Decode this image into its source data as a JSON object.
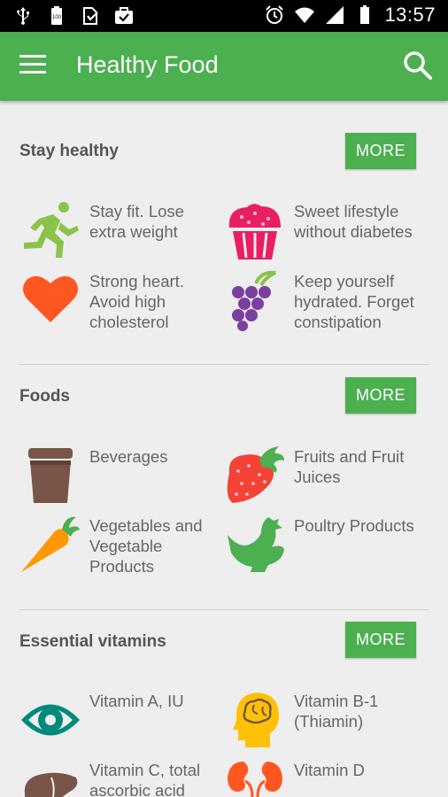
{
  "status": {
    "time": "13:57",
    "battery_level": "100"
  },
  "appbar": {
    "title": "Healthy Food"
  },
  "sections": [
    {
      "title": "Stay healthy",
      "more_label": "MORE",
      "items": [
        {
          "label": "Stay fit. Lose extra weight",
          "icon": "running-person-icon"
        },
        {
          "label": "Sweet lifestyle without diabetes",
          "icon": "cupcake-icon"
        },
        {
          "label": "Strong heart. Avoid high cholesterol",
          "icon": "heart-icon"
        },
        {
          "label": "Keep yourself hydrated. Forget constipation",
          "icon": "grapes-icon"
        }
      ]
    },
    {
      "title": "Foods",
      "more_label": "MORE",
      "items": [
        {
          "label": "Beverages",
          "icon": "coffee-cup-icon"
        },
        {
          "label": "Fruits and Fruit Juices",
          "icon": "strawberry-icon"
        },
        {
          "label": "Vegetables and Vegetable Products",
          "icon": "carrot-icon"
        },
        {
          "label": "Poultry Products",
          "icon": "chicken-icon"
        }
      ]
    },
    {
      "title": "Essential vitamins",
      "more_label": "MORE",
      "items": [
        {
          "label": "Vitamin A, IU",
          "icon": "eye-icon"
        },
        {
          "label": "Vitamin B-1 (Thiamin)",
          "icon": "brain-head-icon"
        },
        {
          "label": "Vitamin C, total ascorbic acid",
          "icon": "liver-icon"
        },
        {
          "label": "Vitamin D",
          "icon": "kidneys-icon"
        }
      ]
    }
  ],
  "colors": {
    "primary": "#4caf50",
    "status_bar": "#000000",
    "background": "#eeeeee",
    "section_title": "#555555",
    "item_text": "#666666"
  }
}
